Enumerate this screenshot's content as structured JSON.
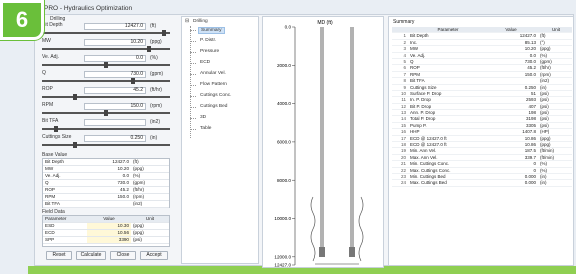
{
  "step_number": "6",
  "window": {
    "title": "PRO - Hydraulics Optimization"
  },
  "left": {
    "group_label": "Drilling",
    "params": [
      {
        "label": "Bit Depth",
        "value": "12427.0",
        "unit": "(ft)",
        "level": 0.97
      },
      {
        "label": "MW",
        "value": "10.20",
        "unit": "(ppg)",
        "level": 0.85
      },
      {
        "label": "Ve. Adj.",
        "value": "0.0",
        "unit": "(%)",
        "level": 0.5
      },
      {
        "label": "Q",
        "value": "730.0",
        "unit": "(gpm)",
        "level": 0.72
      },
      {
        "label": "ROP",
        "value": "45.2",
        "unit": "(ft/hr)",
        "level": 0.25
      },
      {
        "label": "RPM",
        "value": "150.0",
        "unit": "(rpm)",
        "level": 0.5
      },
      {
        "label": "Bit TFA",
        "value": "",
        "unit": "(in2)",
        "level": 0.1
      },
      {
        "label": "Cuttings Size",
        "value": "0.250",
        "unit": "(in)",
        "level": 0.25
      }
    ],
    "base_value_label": "Base Value",
    "base_rows": [
      {
        "name": "Bit Depth",
        "value": "12427.0",
        "unit": "(ft)"
      },
      {
        "name": "MW",
        "value": "10.20",
        "unit": "(ppg)"
      },
      {
        "name": "Ve. Adj.",
        "value": "0.0",
        "unit": "(%)"
      },
      {
        "name": "Q",
        "value": "730.0",
        "unit": "(gpm)"
      },
      {
        "name": "ROP",
        "value": "45.2",
        "unit": "(ft/hr)"
      },
      {
        "name": "RPM",
        "value": "150.0",
        "unit": "(rpm)"
      },
      {
        "name": "Bit TFA",
        "value": "",
        "unit": "(in2)"
      }
    ],
    "field_data_label": "Field Data",
    "field_headers": [
      "Parameter",
      "Value",
      "Unit"
    ],
    "field_rows": [
      {
        "name": "ESD",
        "value": "10.30",
        "unit": "(ppg)"
      },
      {
        "name": "ECD",
        "value": "10.56",
        "unit": "(ppg)"
      },
      {
        "name": "SPP",
        "value": "3390",
        "unit": "(psi)"
      }
    ],
    "buttons": {
      "reset": "Reset",
      "calculate": "Calculate",
      "close": "Close",
      "accept": "Accept"
    }
  },
  "tree": {
    "root": "Drilling",
    "items": [
      "Summary",
      "P. Distr.",
      "Pressure",
      "ECD",
      "Annular Vel.",
      "Flow Pattern",
      "Cuttings Conc.",
      "Cuttings Bed",
      "3D",
      "Table"
    ],
    "selected": "Summary"
  },
  "chart": {
    "axis_title": "MD (ft)",
    "ticks": [
      "0.0",
      "2000.0",
      "4000.0",
      "6000.0",
      "8000.0",
      "10000.0",
      "12000.0",
      "12427.0"
    ]
  },
  "chart_data": {
    "type": "table",
    "title": "",
    "ylabel": "MD (ft)",
    "ylim": [
      0,
      12427
    ]
  },
  "summary": {
    "title": "Summary",
    "headers": [
      "Parameter",
      "Value",
      "Unit"
    ],
    "rows": [
      {
        "i": "1",
        "p": "Bit Depth",
        "v": "12427.0",
        "u": "(ft)"
      },
      {
        "i": "2",
        "p": "Inc.",
        "v": "85.13",
        "u": "(°)"
      },
      {
        "i": "3",
        "p": "MW",
        "v": "10.20",
        "u": "(ppg)"
      },
      {
        "i": "4",
        "p": "Ve. Adj.",
        "v": "0.0",
        "u": "(%)"
      },
      {
        "i": "5",
        "p": "Q",
        "v": "730.0",
        "u": "(gpm)"
      },
      {
        "i": "6",
        "p": "ROP",
        "v": "45.2",
        "u": "(ft/hr)"
      },
      {
        "i": "7",
        "p": "RPM",
        "v": "150.0",
        "u": "(rpm)"
      },
      {
        "i": "8",
        "p": "Bit TFA",
        "v": "",
        "u": "(in2)"
      },
      {
        "i": "9",
        "p": "Cuttings Size",
        "v": "0.250",
        "u": "(in)"
      },
      {
        "i": "10",
        "p": "Surface P. Drop",
        "v": "51",
        "u": "(psi)"
      },
      {
        "i": "11",
        "p": "In. P. Drop",
        "v": "2593",
        "u": "(psi)"
      },
      {
        "i": "12",
        "p": "Bit P. Drop",
        "v": "407",
        "u": "(psi)"
      },
      {
        "i": "13",
        "p": "Ann. P. Drop",
        "v": "198",
        "u": "(psi)"
      },
      {
        "i": "14",
        "p": "Total P. Drop",
        "v": "3198",
        "u": "(psi)"
      },
      {
        "i": "15",
        "p": "Pump P.",
        "v": "3305",
        "u": "(psi)"
      },
      {
        "i": "16",
        "p": "HHP",
        "v": "1407.8",
        "u": "(HP)"
      },
      {
        "i": "17",
        "p": "ECD @ 12427.0 ft",
        "v": "10.86",
        "u": "(ppg)"
      },
      {
        "i": "18",
        "p": "ECD @ 12427.0 ft",
        "v": "10.86",
        "u": "(ppg)"
      },
      {
        "i": "19",
        "p": "Min. Ann Vel.",
        "v": "187.5",
        "u": "(ft/min)"
      },
      {
        "i": "20",
        "p": "Max. Ann Vel.",
        "v": "339.7",
        "u": "(ft/min)"
      },
      {
        "i": "21",
        "p": "Min. Cuttings Conc.",
        "v": "0",
        "u": "(%)"
      },
      {
        "i": "22",
        "p": "Max. Cuttings Conc.",
        "v": "0",
        "u": "(%)"
      },
      {
        "i": "23",
        "p": "Min. Cuttings Bed",
        "v": "0.000",
        "u": "(in)"
      },
      {
        "i": "24",
        "p": "Max. Cuttings Bed",
        "v": "0.000",
        "u": "(in)"
      }
    ]
  }
}
